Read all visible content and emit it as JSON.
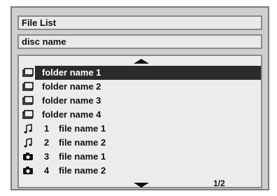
{
  "window": {
    "title": "File List"
  },
  "disc": {
    "name": "disc name"
  },
  "list": {
    "items": [
      {
        "type": "folder",
        "icon": "folder-icon",
        "number": "",
        "label": "folder name 1",
        "selected": true
      },
      {
        "type": "folder",
        "icon": "folder-icon",
        "number": "",
        "label": "folder name 2",
        "selected": false
      },
      {
        "type": "folder",
        "icon": "folder-icon",
        "number": "",
        "label": "folder name 3",
        "selected": false
      },
      {
        "type": "folder",
        "icon": "folder-icon",
        "number": "",
        "label": "folder name 4",
        "selected": false
      },
      {
        "type": "audio",
        "icon": "music-note-icon",
        "number": "1",
        "label": "file name 1",
        "selected": false
      },
      {
        "type": "audio",
        "icon": "music-note-icon",
        "number": "2",
        "label": "file name 2",
        "selected": false
      },
      {
        "type": "photo",
        "icon": "camera-icon",
        "number": "3",
        "label": "file name 1",
        "selected": false
      },
      {
        "type": "photo",
        "icon": "camera-icon",
        "number": "4",
        "label": "file name 2",
        "selected": false
      }
    ],
    "page": "1/2"
  },
  "colors": {
    "panel": "#cfcfcf",
    "field": "#e9e9e9",
    "highlight": "#2b2b2b"
  }
}
